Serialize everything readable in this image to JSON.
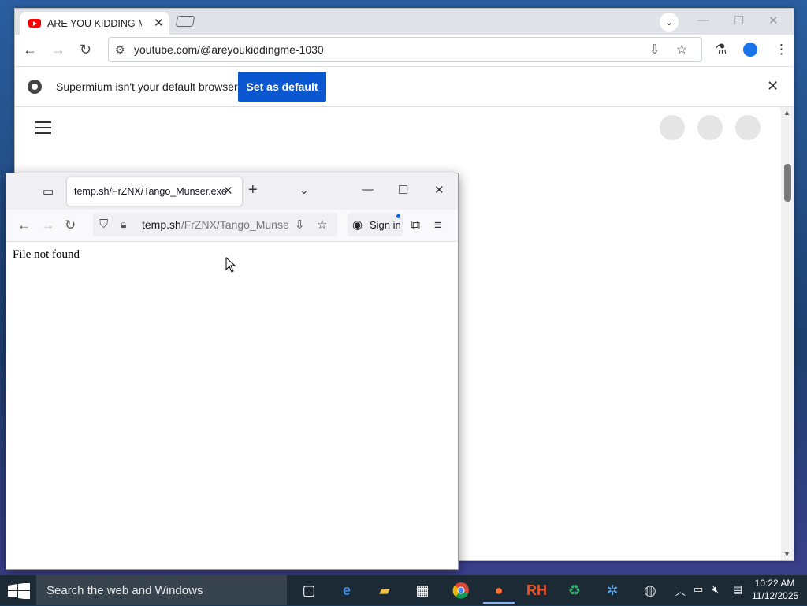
{
  "chrome": {
    "tab_title": "ARE YOU KIDDING ME",
    "url": "youtube.com/@areyoukiddingme-1030",
    "infobar_message": "Supermium isn't your default browser",
    "set_default_label": "Set as default"
  },
  "firefox": {
    "tab_title": "temp.sh/FrZNX/Tango_Munser.exe",
    "url_host": "temp.sh",
    "url_path": "/FrZNX/Tango_Munser.exe",
    "sign_in_label": "Sign in",
    "page_message": "File not found"
  },
  "taskbar": {
    "search_placeholder": "Search the web and Windows",
    "time": "10:22 AM",
    "date": "11/12/2025"
  }
}
